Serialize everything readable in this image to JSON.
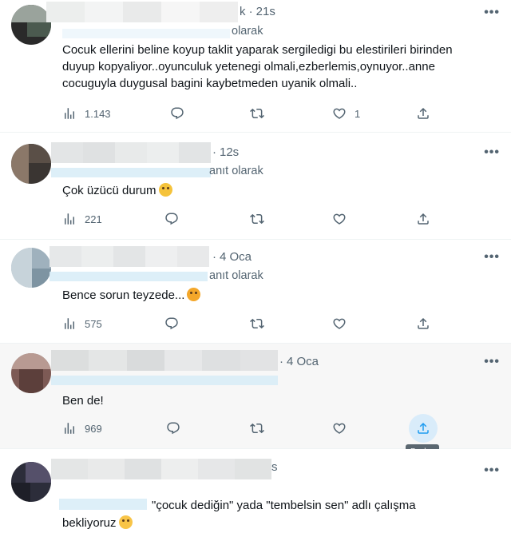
{
  "tweets": [
    {
      "time": "21s",
      "reply_label": "olarak",
      "text": "Cocuk ellerini beline koyup taklit yaparak sergiledigi bu elestirileri birinden duyup kopyaliyor..oyunculuk yetenegi olmali,ezberlemis,oynuyor..anne cocuguyla duygusal bagini kaybetmeden uyanik olmali..",
      "views": "1.143",
      "likes": "1"
    },
    {
      "time": "12s",
      "reply_label": "anıt olarak",
      "text": "Çok üzücü durum",
      "views": "221",
      "likes": ""
    },
    {
      "time": "4 Oca",
      "reply_label": "anıt olarak",
      "text": "Bence sorun teyzede...",
      "views": "575",
      "likes": ""
    },
    {
      "time": "4 Oca",
      "reply_label": "",
      "text": "Ben de!",
      "views": "969",
      "likes": ""
    },
    {
      "time": "s",
      "reply_label": "",
      "text": "\"çocuk dediğin\" yada \"tembelsin sen\" adlı çalışma",
      "text2": "bekliyoruz",
      "views": "",
      "likes": ""
    }
  ],
  "tooltip": "Paylaş",
  "more_label": "•••",
  "icons": [
    "views-icon",
    "reply-icon",
    "retweet-icon",
    "like-icon",
    "share-icon",
    "more-icon"
  ],
  "colors": {
    "text": "#0f1419",
    "secondary": "#536471",
    "accent": "#1d9bf0",
    "divider": "#eff3f4"
  }
}
